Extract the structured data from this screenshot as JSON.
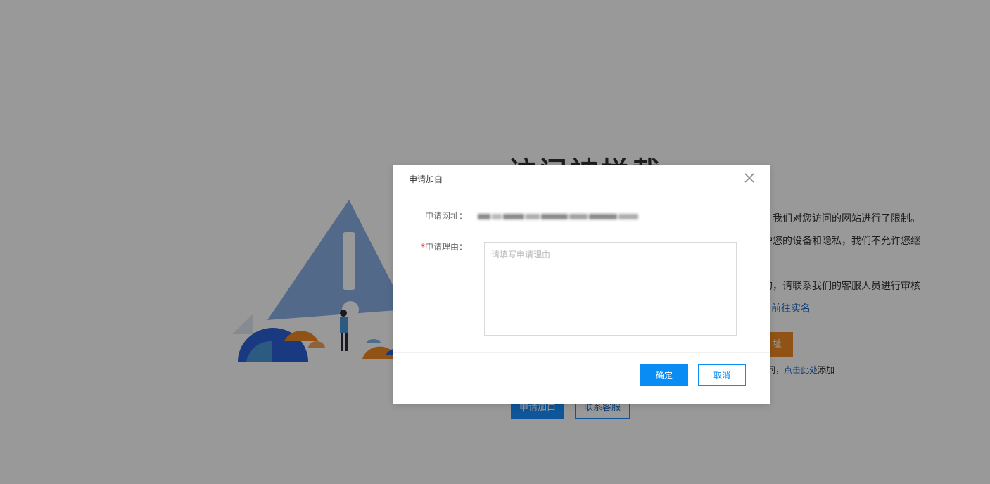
{
  "background": {
    "title": "访问被拦截",
    "lines": [
      "，我们对您访问的网站进行了限制。",
      "护您的设备和隐私，我们不允许您继",
      "的，请联系我们的客服人员进行审核"
    ],
    "realname_link": "前往实名",
    "orange_button": "址",
    "hint_prefix": "问，",
    "hint_link": "点击此处",
    "hint_suffix": "添加",
    "apply_button": "申请加白",
    "contact_button": "联系客服"
  },
  "modal": {
    "title": "申请加白",
    "url_label": "申请网址：",
    "reason_label": "申请理由：",
    "required_mark": "*",
    "reason_placeholder": "请填写申请理由",
    "reason_value": "",
    "ok_label": "确定",
    "cancel_label": "取消"
  },
  "colors": {
    "primary": "#0a8cf5",
    "required": "#f5222d",
    "warning_orange": "#f08a24"
  }
}
